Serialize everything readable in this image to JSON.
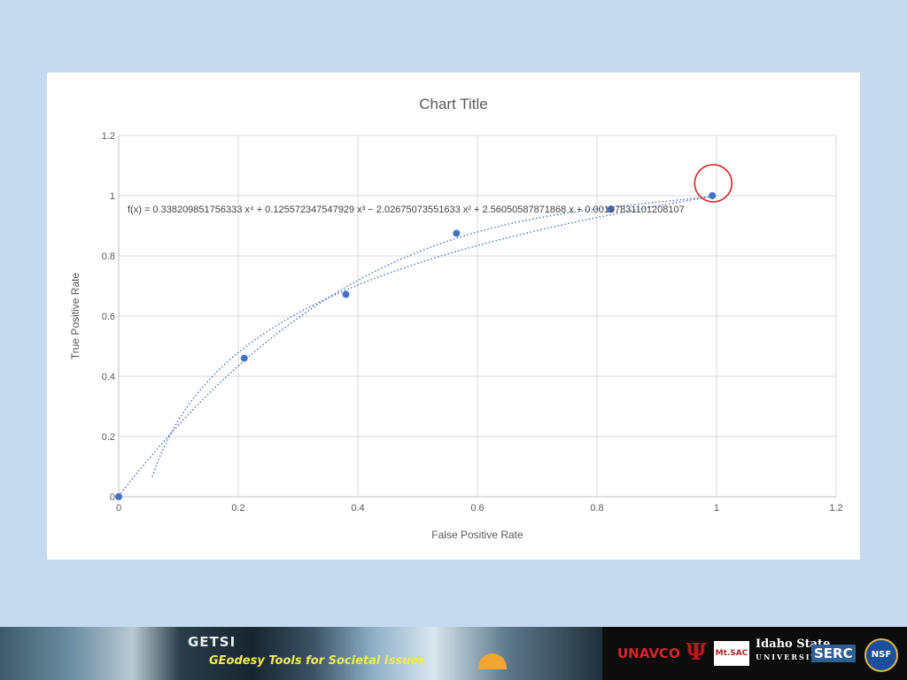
{
  "chart_data": {
    "type": "scatter",
    "title": "Chart Title",
    "xlabel": "False Positive Rate",
    "ylabel": "True Positive Rate",
    "xlim": [
      0,
      1.2
    ],
    "ylim": [
      0,
      1.2
    ],
    "x_ticks": [
      "0",
      "0.2",
      "0.4",
      "0.6",
      "0.8",
      "1",
      "1.2"
    ],
    "y_ticks": [
      "0",
      "0.2",
      "0.4",
      "0.6",
      "0.8",
      "1",
      "1.2"
    ],
    "grid": true,
    "legend": "none",
    "points": [
      [
        0,
        0
      ],
      [
        0.21,
        0.46
      ],
      [
        0.38,
        0.672
      ],
      [
        0.565,
        0.875
      ],
      [
        0.823,
        0.955
      ],
      [
        0.993,
        1.0
      ]
    ],
    "trendline_equation": "f(x) = 0.338209851756333 x⁴ + 0.125572347547929 x³ − 2.02675073551633 x² + 2.56050587871868 x + 0.00197831101208107",
    "trendline_poly_coeffs": [
      0.00197831101208107,
      2.56050587871868,
      -2.02675073551633,
      0.125572347547929,
      0.338209851756333
    ],
    "trendline_log": {
      "a": 0.3237,
      "b": 0.9997,
      "x_range": [
        0.056,
        0.99
      ]
    },
    "highlight_point": [
      0.993,
      1.0
    ],
    "colors": {
      "marker": "#4472c4",
      "trendline": "#4472c4",
      "highlight": "#d62020",
      "grid": "#d9d9d9",
      "text": "#595959"
    }
  },
  "footer": {
    "getsi_name": "GETSI",
    "getsi_tagline": "GEodesy Tools for Societal Issues",
    "partners": {
      "unavco": "UNAVCO",
      "iu": "Ψ",
      "mtsac": "Mt.SAC",
      "isu_line1": "Idaho State",
      "isu_line2": "UNIVERSITY",
      "serc": "SERC",
      "nsf": "NSF"
    }
  }
}
